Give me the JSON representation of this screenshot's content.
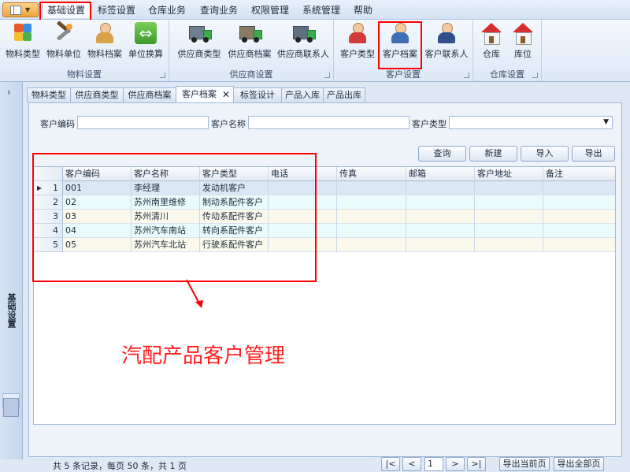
{
  "menu": {
    "items": [
      "基础设置",
      "标签设置",
      "仓库业务",
      "查询业务",
      "权限管理",
      "系统管理",
      "帮助"
    ],
    "active_index": 0
  },
  "ribbon": {
    "groups": [
      {
        "label": "物料设置",
        "buttons": [
          "物料类型",
          "物料单位",
          "物料档案",
          "单位换算"
        ]
      },
      {
        "label": "供应商设置",
        "buttons": [
          "供应商类型",
          "供应商档案",
          "供应商联系人"
        ]
      },
      {
        "label": "客户设置",
        "buttons": [
          "客户类型",
          "客户档案",
          "客户联系人"
        ]
      },
      {
        "label": "仓库设置",
        "buttons": [
          "仓库",
          "库位"
        ]
      }
    ]
  },
  "sidebar": {
    "label": "基础设置"
  },
  "tabs": [
    "物料类型",
    "供应商类型",
    "供应商档案",
    "客户档案",
    "标签设计",
    "产品入库",
    "产品出库"
  ],
  "active_tab_index": 3,
  "filter": {
    "code_label": "客户编码",
    "name_label": "客户名称",
    "type_label": "客户类型",
    "code_value": "",
    "name_value": "",
    "type_value": ""
  },
  "actions": {
    "query": "查询",
    "new": "新建",
    "import": "导入",
    "export": "导出"
  },
  "table": {
    "columns": [
      "客户编码",
      "客户名称",
      "客户类型",
      "电话",
      "传真",
      "邮箱",
      "客户地址",
      "备注"
    ],
    "rows": [
      {
        "no": "1",
        "code": "001",
        "name": "李经理",
        "type": "发动机客户",
        "phone": "",
        "fax": "",
        "email": "",
        "address": "",
        "remark": ""
      },
      {
        "no": "2",
        "code": "02",
        "name": "苏州南里维修",
        "type": "制动系配件客户",
        "phone": "",
        "fax": "",
        "email": "",
        "address": "",
        "remark": ""
      },
      {
        "no": "3",
        "code": "03",
        "name": "苏州清川",
        "type": "传动系配件客户",
        "phone": "",
        "fax": "",
        "email": "",
        "address": "",
        "remark": ""
      },
      {
        "no": "4",
        "code": "04",
        "name": "苏州汽车南站",
        "type": "转向系配件客户",
        "phone": "",
        "fax": "",
        "email": "",
        "address": "",
        "remark": ""
      },
      {
        "no": "5",
        "code": "05",
        "name": "苏州汽车北站",
        "type": "行驶系配件客户",
        "phone": "",
        "fax": "",
        "email": "",
        "address": "",
        "remark": ""
      }
    ]
  },
  "annotation": {
    "text": "汽配产品客户管理",
    "color": "#ff2020"
  },
  "status": {
    "summary": "共 5 条记录，每页 50 条，共 1 页"
  },
  "pager": {
    "first": "|<",
    "prev": "<",
    "page": "1",
    "next": ">",
    "last": ">|",
    "export_current": "导出当前页",
    "export_all": "导出全部页"
  },
  "colors": {
    "accent_red": "#ff0000",
    "selected_row": "#dbe6f6",
    "alt_row": "#e9fbfb"
  }
}
